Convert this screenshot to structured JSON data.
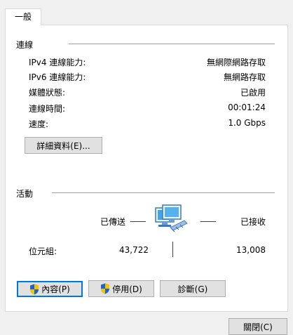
{
  "tab": {
    "general_label": "一般"
  },
  "connection": {
    "section_label": "連線",
    "rows": [
      {
        "label": "IPv4 連線能力:",
        "value": "無網際網路存取"
      },
      {
        "label": "IPv6 連線能力:",
        "value": "無網路存取"
      },
      {
        "label": "媒體狀態:",
        "value": "已啟用"
      },
      {
        "label": "連線時間:",
        "value": "00:01:24"
      },
      {
        "label": "速度:",
        "value": "1.0 Gbps"
      }
    ],
    "details_button": "詳細資料(E)..."
  },
  "activity": {
    "section_label": "活動",
    "sent_label": "已傳送",
    "received_label": "已接收",
    "bytes_label": "位元組:",
    "bytes_sent": "43,722",
    "bytes_received": "13,008"
  },
  "buttons": {
    "properties": "內容(P)",
    "disable": "停用(D)",
    "diagnose": "診斷(G)",
    "close": "關閉(C)"
  },
  "colors": {
    "focus_border": "#0078d7",
    "shield_blue": "#1e64c8",
    "shield_yellow": "#f5c400"
  }
}
